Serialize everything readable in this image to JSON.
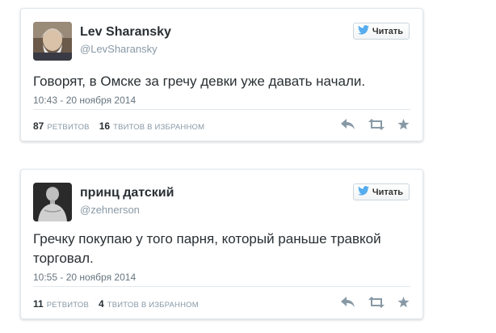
{
  "tweets": [
    {
      "name": "Lev Sharansky",
      "handle": "@LevSharansky",
      "follow_label": "Читать",
      "text": "Говорят, в Омске за гречу девки уже давать начали.",
      "time": "10:43 - 20 ноября 2014",
      "retweets_count": "87",
      "retweets_label": "ретвитов",
      "favorites_count": "16",
      "favorites_label": "твитов в избранном"
    },
    {
      "name": "принц датский",
      "handle": "@zehnerson",
      "follow_label": "Читать",
      "text": "Гречку покупаю у того парня, который раньше травкой торговал.",
      "time": "10:55 - 20 ноября 2014",
      "retweets_count": "11",
      "retweets_label": "ретвитов",
      "favorites_count": "4",
      "favorites_label": "твитов в избранном"
    }
  ],
  "colors": {
    "twitter_blue": "#55acee",
    "action_icon": "#8899a6"
  },
  "icons": [
    "bird-icon",
    "reply-icon",
    "retweet-icon",
    "favorite-icon"
  ]
}
